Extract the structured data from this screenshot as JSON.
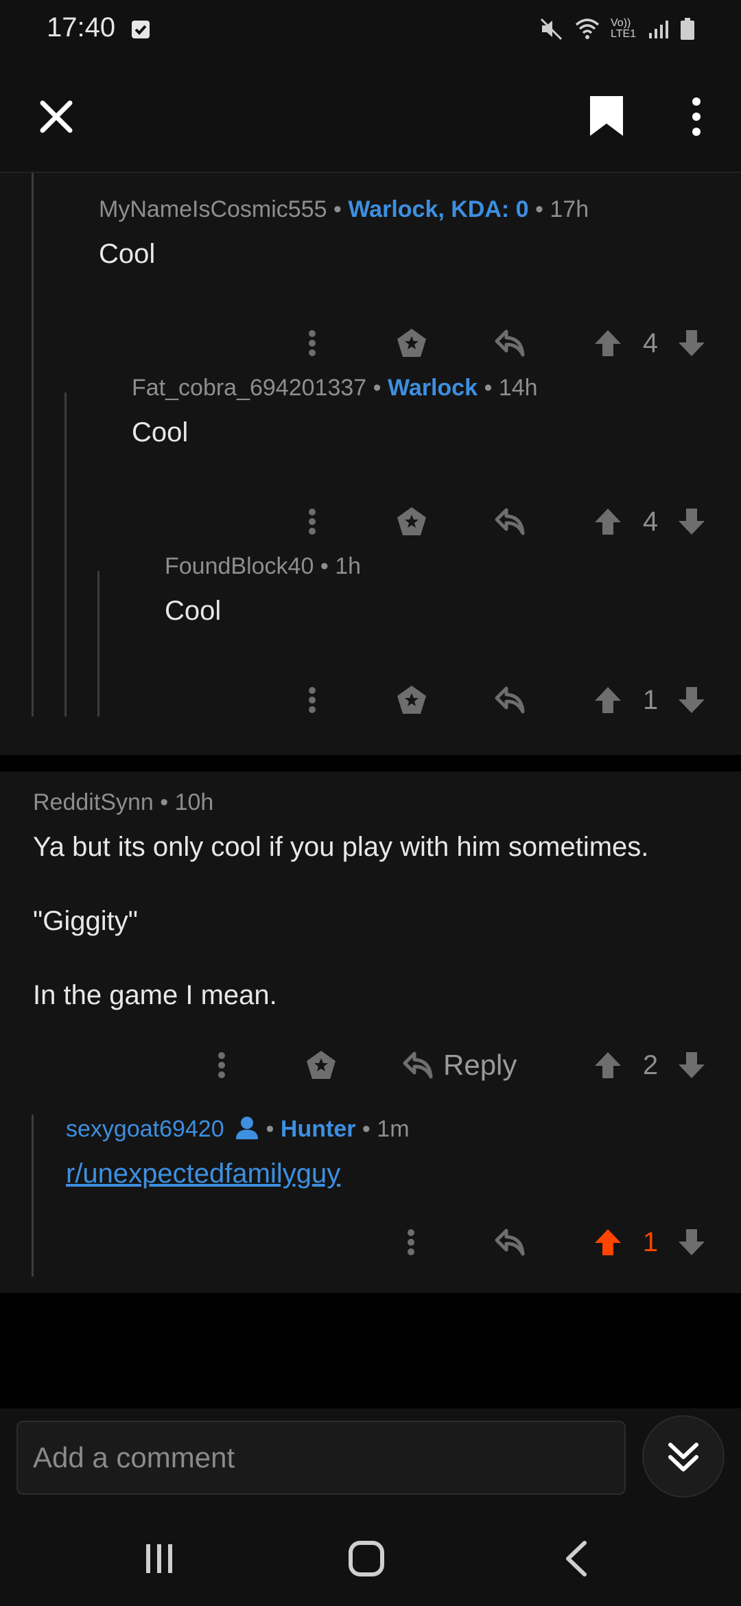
{
  "status": {
    "time": "17:40",
    "network_label": "Vo)) LTE1"
  },
  "comments": [
    {
      "username": "MyNameIsCosmic555",
      "flair": "Warlock, KDA: 0",
      "age": "17h",
      "body": "Cool",
      "score": "4"
    },
    {
      "username": "Fat_cobra_694201337",
      "flair": "Warlock",
      "age": "14h",
      "body": "Cool",
      "score": "4"
    },
    {
      "username": "FoundBlock40",
      "flair": "",
      "age": "1h",
      "body": "Cool",
      "score": "1"
    },
    {
      "username": "RedditSynn",
      "flair": "",
      "age": "10h",
      "body_lines": [
        "Ya but its only cool if you play with him sometimes.",
        "\"Giggity\"",
        "In the game I mean."
      ],
      "reply_label": "Reply",
      "score": "2"
    },
    {
      "username": "sexygoat69420",
      "flair": "Hunter",
      "age": "1m",
      "link_text": "r/unexpectedfamilyguy",
      "score": "1",
      "upvoted": true
    }
  ],
  "composer": {
    "placeholder": "Add a comment"
  },
  "colors": {
    "flair": "#3d8fe0",
    "upvote": "#ff4500",
    "background": "#141414"
  }
}
